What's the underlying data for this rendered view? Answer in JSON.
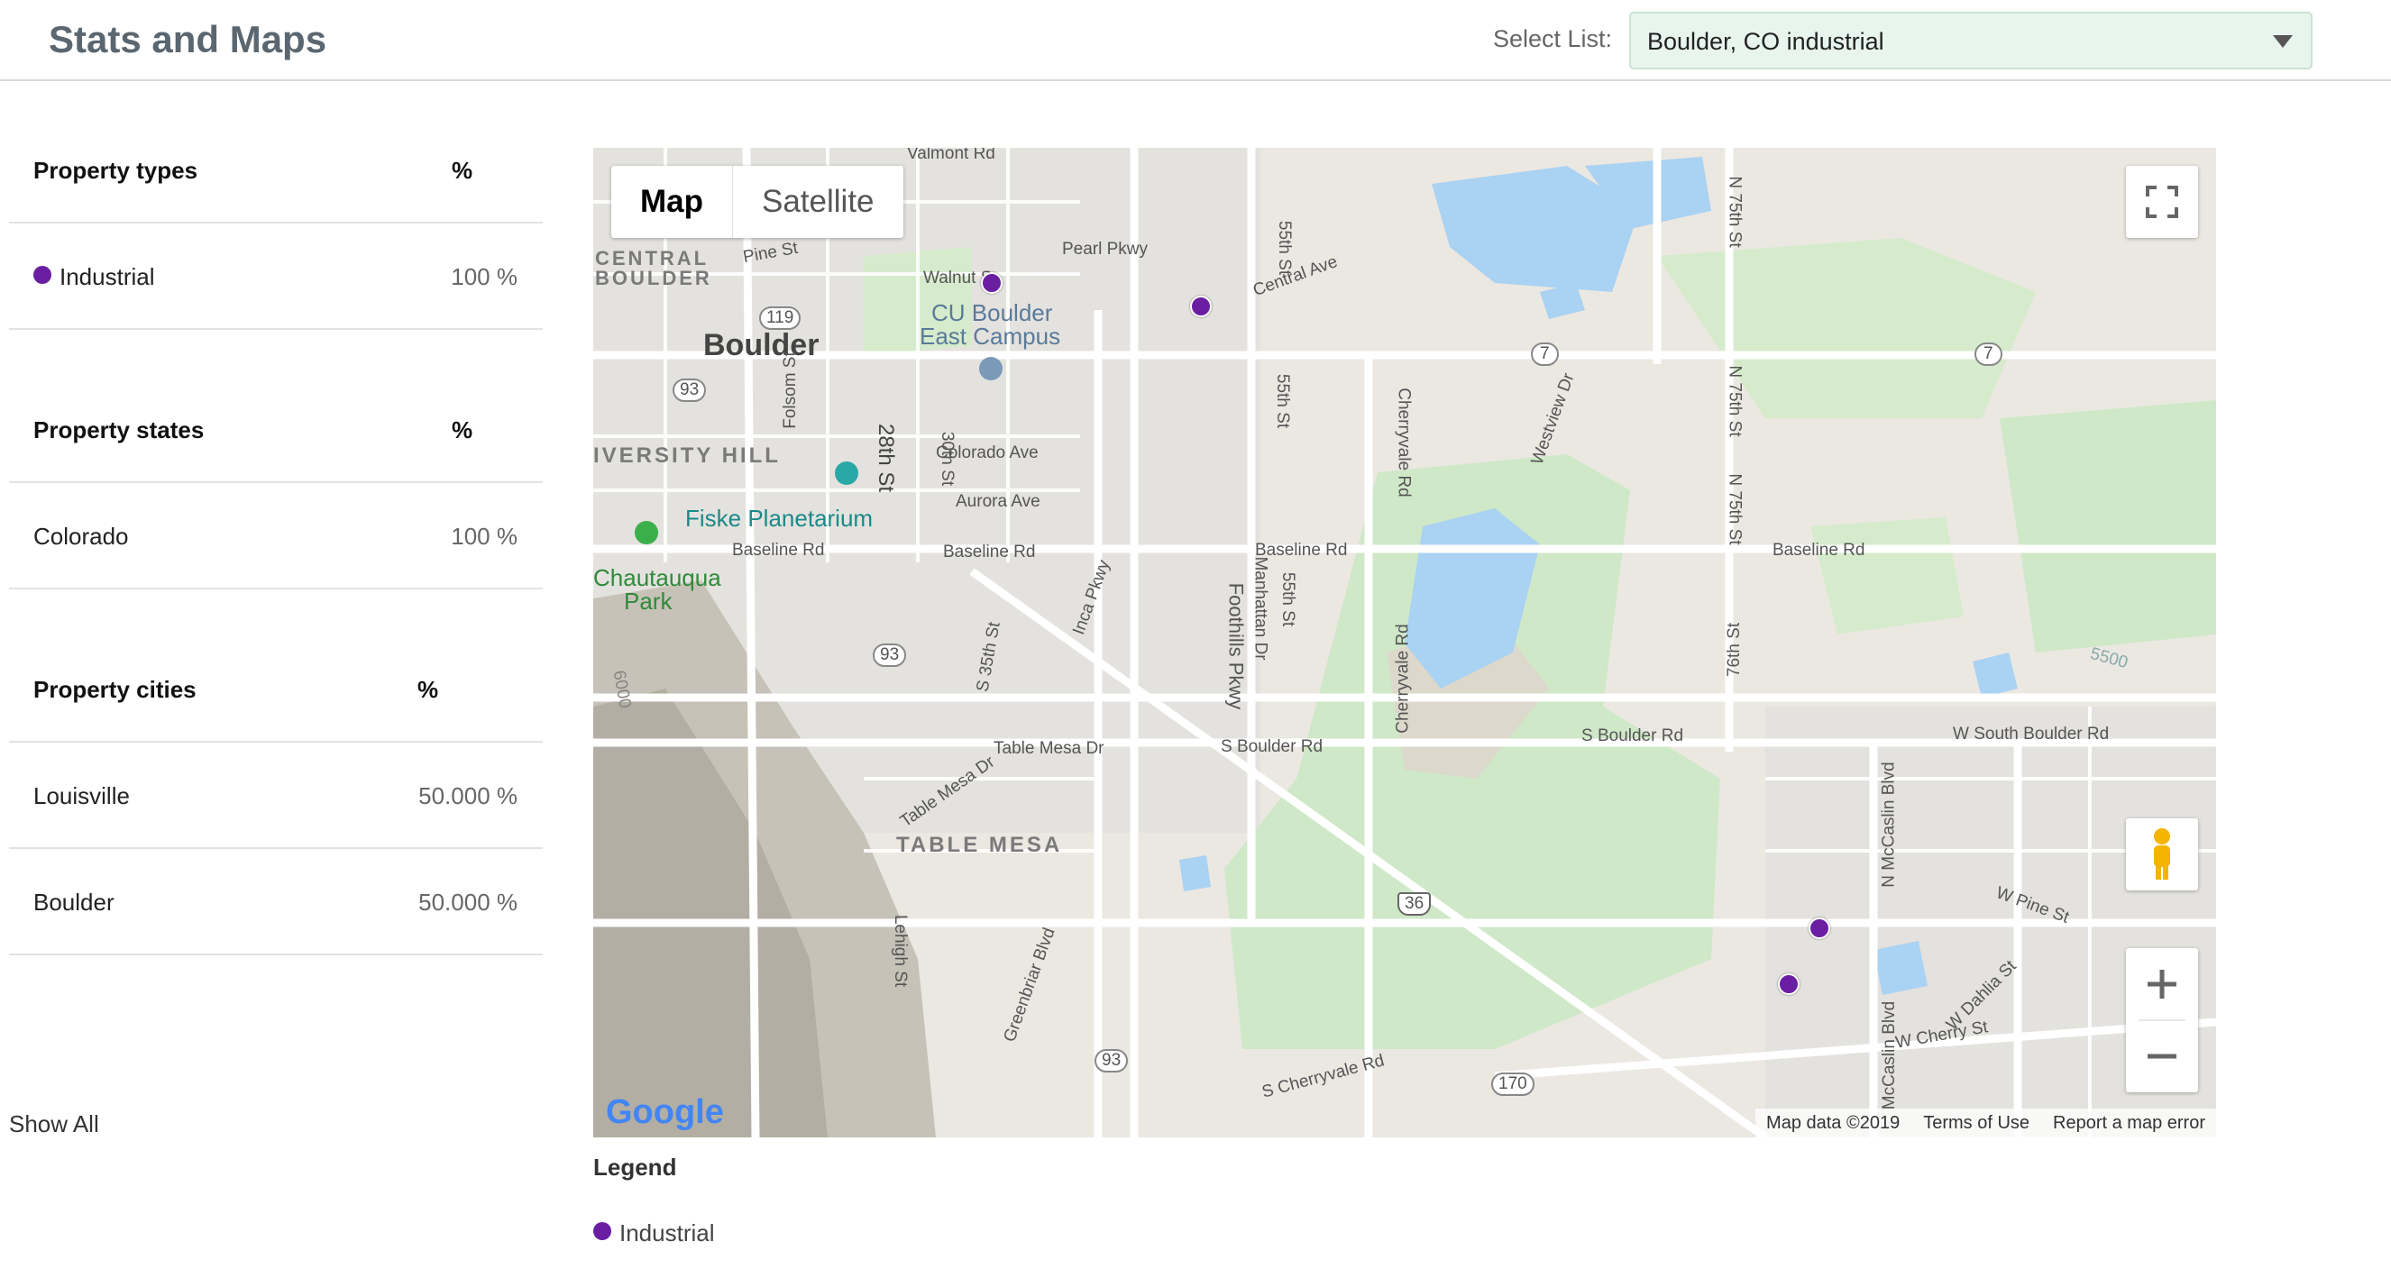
{
  "header": {
    "title": "Stats and Maps",
    "select_label": "Select List:",
    "select_value": "Boulder, CO industrial"
  },
  "sections": [
    {
      "header_label": "Property types",
      "header_pct": "%",
      "rows": [
        {
          "label": "Industrial",
          "value": "100 %",
          "dot": true
        }
      ]
    },
    {
      "header_label": "Property states",
      "header_pct": "%",
      "rows": [
        {
          "label": "Colorado",
          "value": "100 %"
        }
      ]
    },
    {
      "header_label": "Property cities",
      "header_pct": "%",
      "rows": [
        {
          "label": "Louisville",
          "value": "50.000 %"
        },
        {
          "label": "Boulder",
          "value": "50.000 %"
        }
      ]
    }
  ],
  "show_all": "Show All",
  "map": {
    "type_buttons": {
      "map": "Map",
      "satellite": "Satellite"
    },
    "attribution": {
      "data": "Map data ©2019",
      "terms": "Terms of Use",
      "report": "Report a map error"
    },
    "google": "Google",
    "labels": {
      "boulder": "Boulder",
      "cu_boulder": "CU Boulder",
      "east_campus": "East Campus",
      "central_boulder_1": "CENTRAL",
      "central_boulder_2": "BOULDER",
      "university_hill": "IVERSITY HILL",
      "fiske": "Fiske Planetarium",
      "chautauqua_1": "Chautauqua",
      "chautauqua_2": "Park",
      "table_mesa": "TABLE MESA",
      "valmont": "Valmont Rd",
      "pine": "Pine St",
      "walnut": "Walnut S",
      "pearl": "Pearl Pkwy",
      "central_ave": "Central Ave",
      "fifty_fifth_a": "55th St",
      "fifty_fifth_b": "55th St",
      "fifty_fifth_c": "55th St",
      "colorado_ave": "Colorado Ave",
      "aurora": "Aurora Ave",
      "baseline_1": "Baseline Rd",
      "baseline_2": "Baseline Rd",
      "baseline_3": "Baseline Rd",
      "baseline_4": "Baseline Rd",
      "folsom": "Folsom St",
      "twenty_eighth": "28th St",
      "thirtieth": "30th St",
      "cherryvale_1": "Cherryvale Rd",
      "cherryvale_2": "Cherryvale Rd",
      "westview": "Westview Dr",
      "n75_1": "N 75th St",
      "n75_2": "N 75th St",
      "n75_3": "N 75th St",
      "seventy_sixth": "76th St",
      "foothills": "Foothills Pkwy",
      "manhattan": "Manhattan Dr",
      "inca": "Inca Pkwy",
      "s35": "S 35th St",
      "table_mesa_dr_1": "Table Mesa Dr",
      "table_mesa_dr_2": "Table Mesa Dr",
      "s_boulder_1": "S Boulder Rd",
      "s_boulder_2": "S Boulder Rd",
      "w_south_boulder": "W South Boulder Rd",
      "lehigh": "Lehigh St",
      "greenbriar": "Greenbriar Blvd",
      "s_cherryvale": "S Cherryvale Rd",
      "n_mccaslin": "N McCaslin Blvd",
      "mccaslin": "McCaslin Blvd",
      "w_pine": "W Pine St",
      "w_dahlia": "W Dahlia St",
      "w_cherry": "W Cherry St",
      "rt7a": "7",
      "rt7b": "7",
      "rt119": "119",
      "rt93a": "93",
      "rt93b": "93",
      "rt93c": "93",
      "rt36": "36",
      "rt170": "170",
      "elev_5500": "5500",
      "elev_6000": "6000"
    }
  },
  "legend": {
    "title": "Legend",
    "items": [
      {
        "label": "Industrial"
      }
    ]
  },
  "colors": {
    "marker": "#6a1fa3",
    "select_bg": "#e8f5ee",
    "park": "#cfe8c8",
    "water": "#aad2f2",
    "road": "#ffffff"
  }
}
